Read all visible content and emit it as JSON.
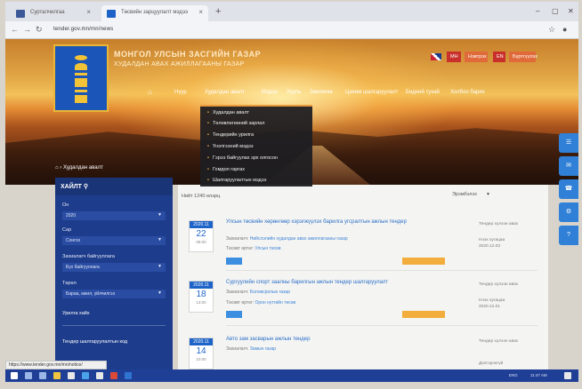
{
  "browser": {
    "tabs": [
      {
        "label": "Сурталчилгаа",
        "favicon_color": "#3b5998"
      },
      {
        "label": "Төсвийн зарцуулалт мэдээ",
        "favicon_color": "#1e63c8"
      }
    ],
    "url": "tender.gov.mn/mn/news",
    "window_controls": [
      "–",
      "▢",
      "✕"
    ]
  },
  "site": {
    "title": "МОНГОЛ УЛСЫН ЗАСГИЙН ГАЗАР",
    "subtitle": "ХУДАЛДАН АВАХ АЖИЛЛАГААНЫ ГАЗАР",
    "lang_buttons": [
      "МН",
      "Нэвтрэх",
      "EN",
      "Бүртгүүлэх"
    ],
    "menu": [
      "Нүүр",
      "Худалдан авалт",
      "Мэдээ",
      "Хууль",
      "Зөвлөгөө",
      "Цахим шалгаруулалт",
      "Бидний тухай",
      "Холбоо барих"
    ],
    "breadcrumb": "Худалдан авалт"
  },
  "dropdown": {
    "items": [
      "Худалдан авалт",
      "Төлөвлөгөөний зарлал",
      "Тендерийн урилга",
      "Үнэлгээний мэдээ",
      "Гэрээ байгуулах эрх олгосон",
      "Гомдол гаргах",
      "Шалгаруулалтын мэдээ"
    ]
  },
  "right_tabs": [
    "☰",
    "✉",
    "☎",
    "⚙",
    "?"
  ],
  "sidebar": {
    "header": "ХАЙЛТ",
    "search_icon": "search-icon",
    "fields": [
      {
        "label": "Он",
        "value": "2020"
      },
      {
        "label": "Сар",
        "value": "Сонгох"
      },
      {
        "label": "Захиалагч байгууллага",
        "value": "Бүх байгууллага"
      },
      {
        "label": "Төрөл",
        "value": "Бараа, ажил, үйлчилгээ"
      }
    ],
    "links": [
      "Урилга хайх",
      "Тендер шалгаруулалтын код"
    ]
  },
  "main": {
    "count_text": "Нийт 1240 илэрц",
    "sort_label": "Эрэмбэлэх",
    "news": [
      {
        "date_ym": "2020.11",
        "date_day": "22",
        "date_time": "09:00",
        "title": "Улсын төсвийн хөрөнгөөр хэрэгжүүлэх барилга угсралтын ажлын тендер",
        "line1_label": "Захиалагч: ",
        "line1_value": "Нийслэлийн худалдан авах ажиллагааны газар",
        "line2_label": "Төсөвт өртөг: ",
        "line2_value": "Улсын төсөв",
        "right_a": "Тендер хүлээн авах",
        "right_b": "Нээх хугацаа",
        "right_c": "2020.12.03"
      },
      {
        "date_ym": "2020.11",
        "date_day": "18",
        "date_time": "13:00",
        "title": "Сургуулийн спорт заалны барилгын ажлын тендер шалгаруулалт",
        "line1_label": "Захиалагч: ",
        "line1_value": "Боловсролын газар",
        "line2_label": "Төсөвт өртөг: ",
        "line2_value": "Орон нутгийн төсөв",
        "right_a": "Тендер хүлээн авах",
        "right_b": "Нээх хугацаа",
        "right_c": "2020.12.01"
      },
      {
        "date_ym": "2020.11",
        "date_day": "14",
        "date_time": "10:00",
        "title": "Авто зам засварын ажлын тендер",
        "line1_label": "Захиалагч: ",
        "line1_value": "Замын газар",
        "line2_label": "",
        "line2_value": "",
        "right_a": "Тендер хүлээн авах",
        "right_b": "",
        "right_c": "Дэлгэрэнгүй"
      }
    ]
  },
  "status_text": "https://www.tender.gov.mn/mn/notice/",
  "taskbar": {
    "clock": "11:47 AM",
    "tray": "ENG"
  }
}
